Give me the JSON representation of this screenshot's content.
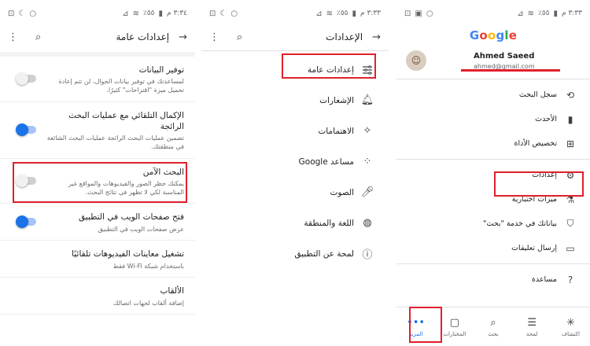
{
  "panel1": {
    "status": {
      "time": "٣:٣٤ م",
      "battery": "٪٥٥"
    },
    "topbar": {
      "title": "إعدادات عامة"
    },
    "settings": [
      {
        "title": "توفير البيانات",
        "desc": "لمساعدتك في توفير بيانات الجوال، لن تتم إعادة تحميل ميزة \"اقتراحات\" كثيرًا.",
        "toggle": "off"
      },
      {
        "title": "الإكمال التلقائي مع عمليات البحث الرائجة",
        "desc": "تضمين عمليات البحث الرائجة عمليات البحث الشائعة في منطقتك.",
        "toggle": "on"
      },
      {
        "title": "البحث الآمن",
        "desc": "يمكنك حظر الصور والفيديوهات والمواقع غير المناسبة لكي لا تظهر في نتائج البحث.",
        "toggle": "off"
      },
      {
        "title": "فتح صفحات الويب في التطبيق",
        "desc": "عرض صفحات الويب في التطبيق",
        "toggle": "on"
      },
      {
        "title": "تشغيل معاينات الفيديوهات تلقائيًا",
        "desc": "باستخدام شبكة Wi-Fi فقط",
        "toggle": "none"
      },
      {
        "title": "الألقاب",
        "desc": "إضافة ألقاب لجهات اتصالك",
        "toggle": "none"
      }
    ]
  },
  "panel2": {
    "status": {
      "time": "٣:٣٣ م",
      "battery": "٪٥٥"
    },
    "topbar": {
      "title": "الإعدادات"
    },
    "items": [
      {
        "label": "إعدادات عامة",
        "icon": "sliders"
      },
      {
        "label": "الإشعارات",
        "icon": "bell"
      },
      {
        "label": "الاهتمامات",
        "icon": "wand"
      },
      {
        "label": "مساعد Google",
        "icon": "assistant"
      },
      {
        "label": "الصوت",
        "icon": "mic"
      },
      {
        "label": "اللغة والمنطقة",
        "icon": "globe"
      },
      {
        "label": "لمحة عن التطبيق",
        "icon": "info"
      }
    ]
  },
  "panel3": {
    "status": {
      "time": "٣:٣٣ م",
      "battery": "٪٥٥"
    },
    "logo": [
      "G",
      "o",
      "o",
      "g",
      "l",
      "e"
    ],
    "logo_colors": [
      "#4285F4",
      "#EA4335",
      "#FBBC05",
      "#4285F4",
      "#34A853",
      "#EA4335"
    ],
    "account": {
      "name": "Ahmed Saeed",
      "email": "ahmed@gmail.com"
    },
    "items": [
      {
        "label": "سجل البحث",
        "icon": "history"
      },
      {
        "label": "الأحدث",
        "icon": "recent"
      },
      {
        "label": "تخصيص الأداة",
        "icon": "widget"
      },
      {
        "label": "إعدادات",
        "icon": "gear"
      },
      {
        "label": "ميزات اختبارية",
        "icon": "flask"
      },
      {
        "label": "بياناتك في خدمة \"بحث\"",
        "icon": "shield"
      },
      {
        "label": "إرسال تعليقات",
        "icon": "feedback"
      },
      {
        "label": "مساعدة",
        "icon": "help"
      }
    ],
    "bottomnav": [
      {
        "label": "المزيد",
        "icon": "•••",
        "active": true
      },
      {
        "label": "المختارات",
        "icon": "▢"
      },
      {
        "label": "بحث",
        "icon": "⌕"
      },
      {
        "label": "لمحة",
        "icon": "☰"
      },
      {
        "label": "اكتشاف",
        "icon": "✳"
      }
    ]
  },
  "colors": {
    "accent": "#1a73e8",
    "highlight": "#e0202b"
  }
}
